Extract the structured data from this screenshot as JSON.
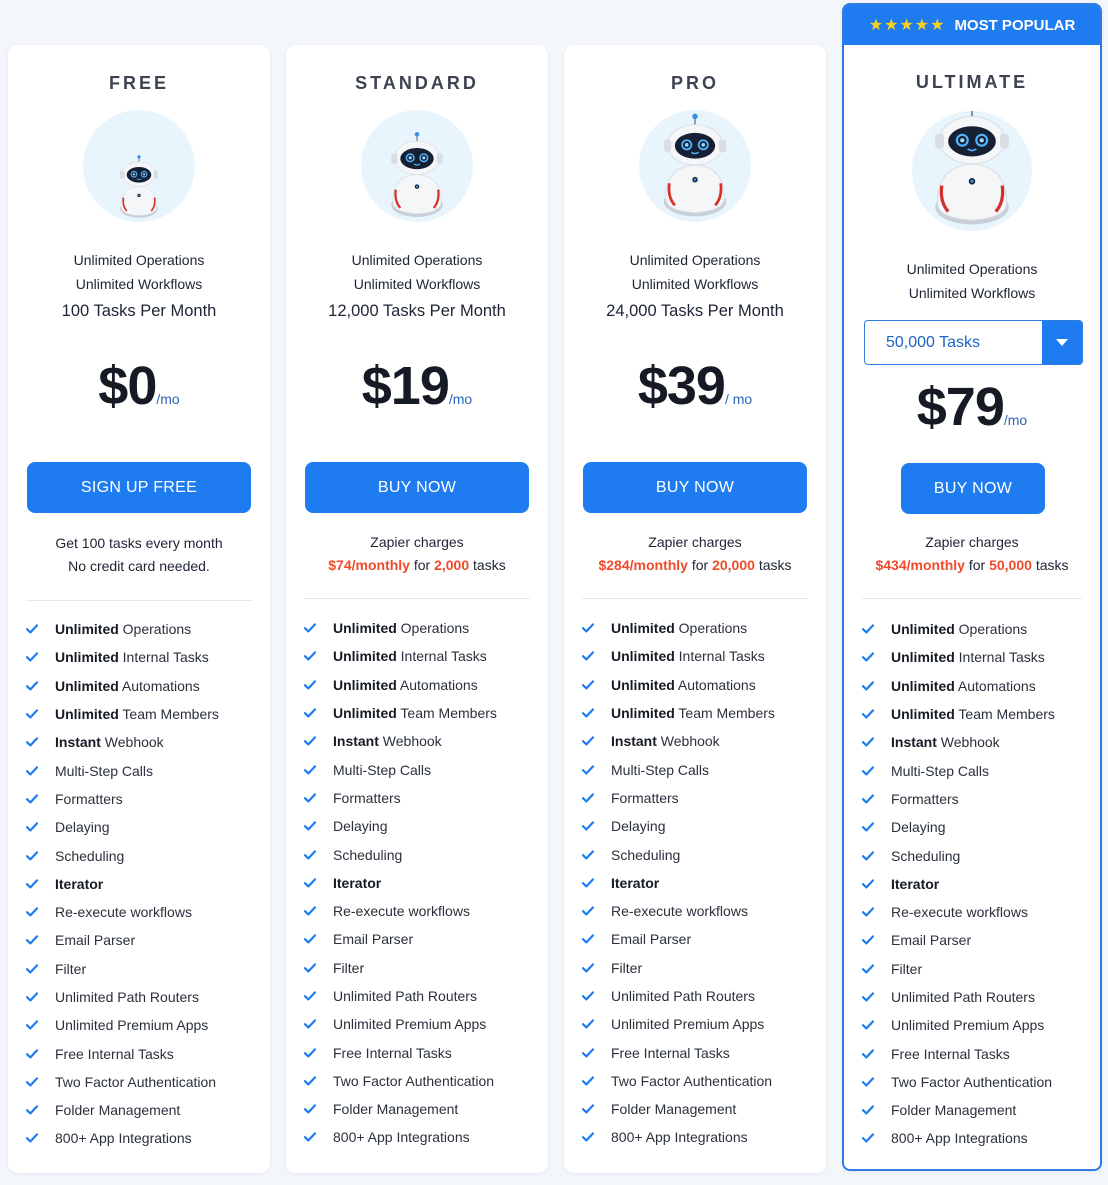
{
  "accent_color": "#1f7cf0",
  "highlight_color": "#ef4a2a",
  "check_icon": "checkmark-icon",
  "plans": [
    {
      "name": "FREE",
      "ops": "Unlimited Operations",
      "workflows": "Unlimited Workflows",
      "tasks": "100 Tasks Per Month",
      "price": "$0",
      "per": "/mo",
      "button": "SIGN UP FREE",
      "note1": "Get 100 tasks every month",
      "note2": "No credit card needed."
    },
    {
      "name": "STANDARD",
      "ops": "Unlimited Operations",
      "workflows": "Unlimited Workflows",
      "tasks": "12,000 Tasks Per Month",
      "price": "$19",
      "per": "/mo",
      "button": "BUY NOW",
      "note1": "Zapier charges",
      "note_price": "$74/monthly",
      "note_for": "for",
      "note_count": "2,000",
      "note_tasks": "tasks"
    },
    {
      "name": "PRO",
      "ops": "Unlimited Operations",
      "workflows": "Unlimited Workflows",
      "tasks": "24,000 Tasks Per Month",
      "price": "$39",
      "per": "/ mo",
      "button": "BUY NOW",
      "note1": "Zapier charges",
      "note_price": "$284/monthly",
      "note_for": "for",
      "note_count": "20,000",
      "note_tasks": "tasks"
    },
    {
      "name": "ULTIMATE",
      "badge": "MOST POPULAR",
      "badge_stars": "★★★★★",
      "ops": "Unlimited Operations",
      "workflows": "Unlimited Workflows",
      "select_value": "50,000 Tasks",
      "price": "$79",
      "per": "/mo",
      "button": "BUY NOW",
      "note1": "Zapier charges",
      "note_price": "$434/monthly",
      "note_for": "for",
      "note_count": "50,000",
      "note_tasks": "tasks"
    }
  ],
  "features": [
    {
      "bold": "Unlimited",
      "text": " Operations"
    },
    {
      "bold": "Unlimited",
      "text": " Internal Tasks"
    },
    {
      "bold": "Unlimited",
      "text": " Automations"
    },
    {
      "bold": "Unlimited",
      "text": " Team Members"
    },
    {
      "bold": "Instant",
      "text": " Webhook"
    },
    {
      "bold": "",
      "text": "Multi-Step Calls"
    },
    {
      "bold": "",
      "text": "Formatters"
    },
    {
      "bold": "",
      "text": "Delaying"
    },
    {
      "bold": "",
      "text": "Scheduling"
    },
    {
      "bold": "Iterator",
      "text": ""
    },
    {
      "bold": "",
      "text": "Re-execute workflows"
    },
    {
      "bold": "",
      "text": "Email Parser"
    },
    {
      "bold": "",
      "text": "Filter"
    },
    {
      "bold": "",
      "text": "Unlimited Path Routers"
    },
    {
      "bold": "",
      "text": "Unlimited Premium Apps"
    },
    {
      "bold": "",
      "text": "Free Internal Tasks"
    },
    {
      "bold": "",
      "text": "Two Factor Authentication"
    },
    {
      "bold": "",
      "text": "Folder Management"
    },
    {
      "bold": "",
      "text": "800+ App Integrations"
    }
  ]
}
